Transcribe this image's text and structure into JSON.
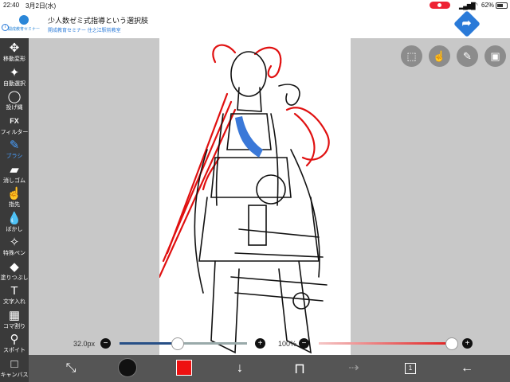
{
  "status_bar": {
    "time": "22:40",
    "date": "3月2日(水)",
    "battery": "62%"
  },
  "ad": {
    "logo_text": "開成教育セミナー",
    "title": "少人数ゼミ式指導という選択肢",
    "subtitle": "開成教育セミナー 住之江駅前教室",
    "info_icon": "i",
    "go_icon": "arrow-turn-right"
  },
  "tools": [
    {
      "name": "move",
      "label": "移動変形",
      "icon": "✥"
    },
    {
      "name": "auto-select",
      "label": "自動選択",
      "icon": "✦"
    },
    {
      "name": "lasso",
      "label": "投げ縄",
      "icon": "◯"
    },
    {
      "name": "filter",
      "label": "フィルター",
      "icon": "FX"
    },
    {
      "name": "brush",
      "label": "ブラシ",
      "icon": "✎",
      "active": true
    },
    {
      "name": "eraser",
      "label": "消しゴム",
      "icon": "▰"
    },
    {
      "name": "smudge",
      "label": "指先",
      "icon": "☝"
    },
    {
      "name": "blur",
      "label": "ぼかし",
      "icon": "💧"
    },
    {
      "name": "special-pen",
      "label": "特殊ペン",
      "icon": "✧"
    },
    {
      "name": "fill",
      "label": "塗りつぶし",
      "icon": "◆"
    },
    {
      "name": "text",
      "label": "文字入れ",
      "icon": "T"
    },
    {
      "name": "frame",
      "label": "コマ割り",
      "icon": "▦"
    },
    {
      "name": "eyedropper",
      "label": "スポイト",
      "icon": "⚲"
    },
    {
      "name": "canvas",
      "label": "キャンバス",
      "icon": "□"
    }
  ],
  "top_buttons": [
    {
      "name": "selection",
      "icon": "⬚"
    },
    {
      "name": "gesture",
      "icon": "☝"
    },
    {
      "name": "pencil",
      "icon": "✎"
    },
    {
      "name": "image",
      "icon": "▣"
    }
  ],
  "brush": {
    "size_label": "32.0px",
    "size_fraction": 0.45,
    "opacity_label": "100%",
    "opacity_fraction": 1.0,
    "minus": "−",
    "plus": "+"
  },
  "bottom": {
    "transform_icon": "⤡",
    "undo_icon": "↓",
    "redo_icon": "⇢",
    "layers_count": "1",
    "back_icon": "←",
    "color": "#ee1111"
  }
}
